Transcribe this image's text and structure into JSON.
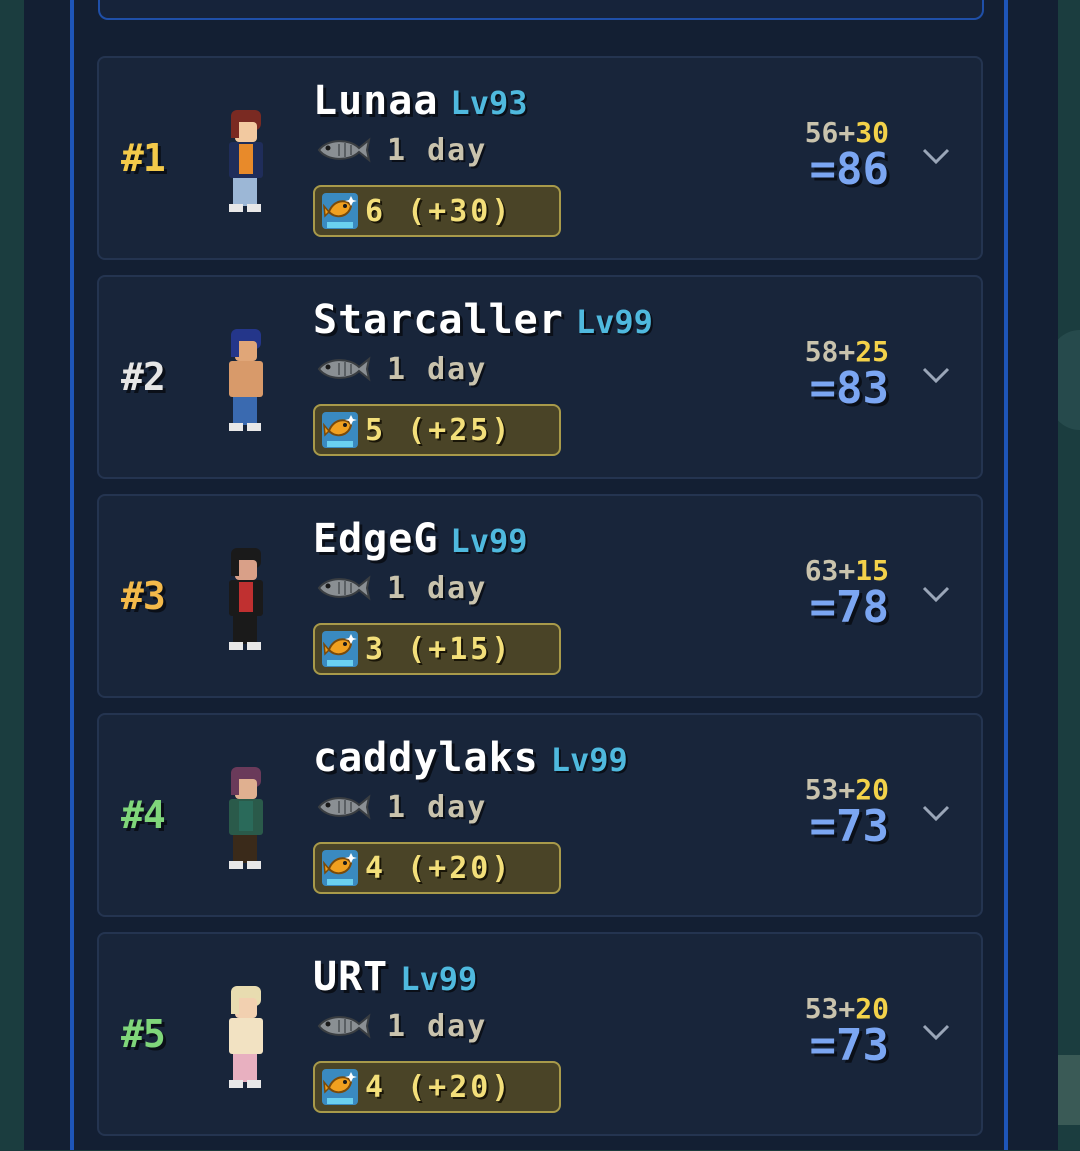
{
  "leaderboard": {
    "entries": [
      {
        "rank": "#1",
        "rank_color": "#f3c94a",
        "name": "Lunaa",
        "level": "Lv93",
        "duration": "1 day",
        "catch": "6 (+30)",
        "base": "56",
        "plus": "+",
        "bonus": "30",
        "total": "=86",
        "avatar": {
          "hair": "#7a2a22",
          "shirt": "#e88a2a",
          "jacket": "#1f2d5a",
          "pants": "#9cb7d6",
          "skin": "#f2c9a0"
        }
      },
      {
        "rank": "#2",
        "rank_color": "#e6e6e6",
        "name": "Starcaller",
        "level": "Lv99",
        "duration": "1 day",
        "catch": "5 (+25)",
        "base": "58",
        "plus": "+",
        "bonus": "25",
        "total": "=83",
        "avatar": {
          "hair": "#24368a",
          "shirt": "#d89a6a",
          "jacket": "#d89a6a",
          "pants": "#3a6ab0",
          "skin": "#e0a678"
        }
      },
      {
        "rank": "#3",
        "rank_color": "#f3b94a",
        "name": "EdgeG",
        "level": "Lv99",
        "duration": "1 day",
        "catch": "3 (+15)",
        "base": "63",
        "plus": "+",
        "bonus": "15",
        "total": "=78",
        "avatar": {
          "hair": "#1a1a1a",
          "shirt": "#c03030",
          "jacket": "#1a1a1a",
          "pants": "#1a1a1a",
          "skin": "#d9a088"
        }
      },
      {
        "rank": "#4",
        "rank_color": "#7fd67a",
        "name": "caddylaks",
        "level": "Lv99",
        "duration": "1 day",
        "catch": "4 (+20)",
        "base": "53",
        "plus": "+",
        "bonus": "20",
        "total": "=73",
        "avatar": {
          "hair": "#6a3a5a",
          "shirt": "#2a6a5a",
          "jacket": "#2a5a4a",
          "pants": "#3a2a1a",
          "skin": "#e0b090"
        }
      },
      {
        "rank": "#5",
        "rank_color": "#7fd67a",
        "name": "URT",
        "level": "Lv99",
        "duration": "1 day",
        "catch": "4 (+20)",
        "base": "53",
        "plus": "+",
        "bonus": "20",
        "total": "=73",
        "avatar": {
          "hair": "#e8dcb0",
          "shirt": "#f2e2c2",
          "jacket": "#f2e2c2",
          "pants": "#e8b0c0",
          "skin": "#f2d0b0"
        }
      }
    ]
  },
  "icons": {
    "fish": "fish-icon",
    "catch": "golden-fish-icon",
    "expand": "chevron-down-icon"
  },
  "colors": {
    "level": "#4fb9de",
    "total": "#7ba6f2",
    "bonus": "#f3d24a",
    "badge_bg": "#4a4427",
    "badge_border": "#a89a4a"
  }
}
